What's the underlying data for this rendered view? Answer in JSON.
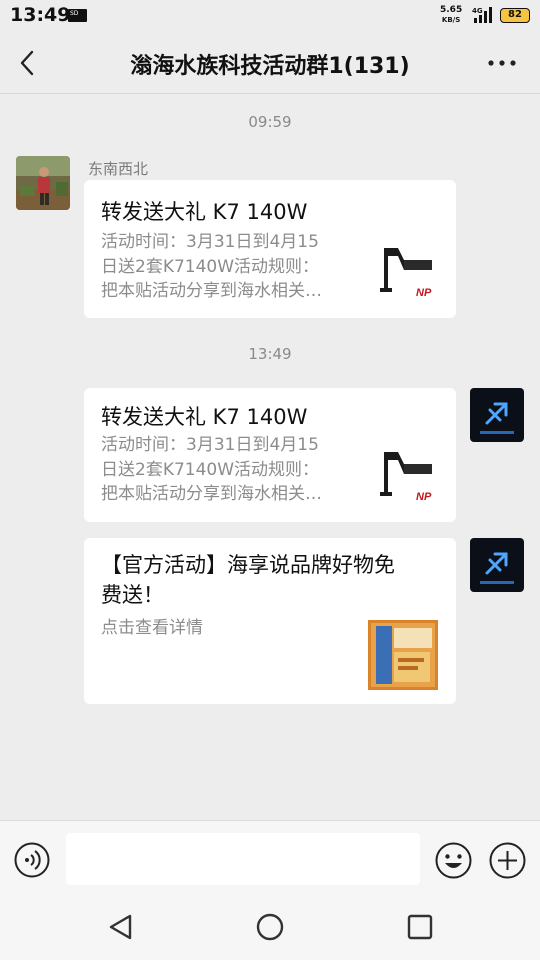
{
  "status_bar": {
    "time": "13:49",
    "sd_label": "SD",
    "net_speed_value": "5.65",
    "net_speed_unit": "KB/S",
    "network_type": "4G",
    "battery": "82"
  },
  "header": {
    "title": "滃海水族科技活动群1(131)",
    "back_icon": "chevron-left-icon",
    "more_icon": "more-dots-icon"
  },
  "messages": [
    {
      "timestamp": "09:59",
      "sender": "东南西北",
      "side": "left",
      "title": "转发送大礼 K7 140W",
      "desc_lines": [
        "活动时间：3月31日到4月15",
        "日送2套K7140W活动规则：",
        "把本贴活动分享到海水相关…"
      ],
      "thumb_text": "NP"
    },
    {
      "timestamp": "13:49",
      "side": "right",
      "title": "转发送大礼 K7 140W",
      "desc_lines": [
        "活动时间：3月31日到4月15",
        "日送2套K7140W活动规则：",
        "把本贴活动分享到海水相关…"
      ],
      "thumb_text": "NP"
    },
    {
      "side": "right",
      "title_lines": [
        "【官方活动】海享说品牌好物免",
        "费送！"
      ],
      "desc_lines": [
        "点击查看详情"
      ]
    }
  ],
  "input_bar": {
    "placeholder": "",
    "voice_icon": "voice-icon",
    "emoji_icon": "emoji-icon",
    "plus_icon": "plus-icon"
  },
  "system_nav": {
    "back_icon": "triangle-back-icon",
    "home_icon": "circle-home-icon",
    "recents_icon": "square-recents-icon"
  },
  "colors": {
    "background": "#ededed",
    "card": "#ffffff",
    "muted_text": "#8c8c8c",
    "battery": "#f5c542"
  }
}
